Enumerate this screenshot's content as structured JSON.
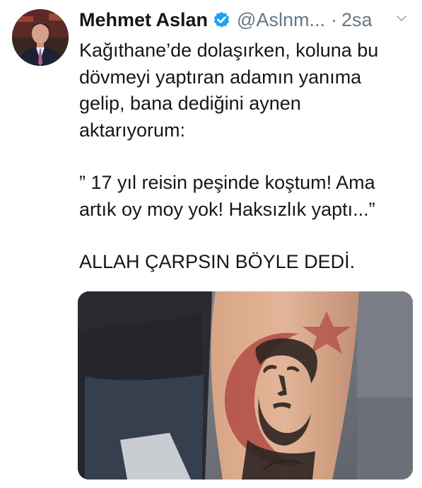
{
  "tweet": {
    "author_name": "Mehmet Aslan",
    "handle": "@Aslnm...",
    "separator": "·",
    "time": "2sa",
    "lines": [
      "Kağıthane’de dolaşırken, koluna bu",
      "dövmeyi yaptıran adamın yanıma",
      "gelip, bana dediğini aynen",
      "aktarıyorum:"
    ],
    "quote_lines": [
      "” 17 yıl reisin peşinde koştum! Ama",
      "artık oy moy yok! Haksızlık yaptı...”"
    ],
    "closing": "ALLAH ÇARPSIN BÖYLE DEDİ.",
    "icons": {
      "verified": "verified-badge-icon",
      "menu": "chevron-down-icon"
    },
    "colors": {
      "verified_blue": "#1da1f2",
      "secondary_text": "#657786",
      "primary_text": "#14171a"
    }
  }
}
